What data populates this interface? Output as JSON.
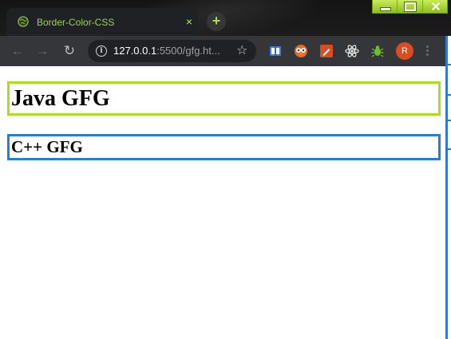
{
  "browser": {
    "tab": {
      "title": "Border-Color-CSS",
      "close_glyph": "×",
      "favicon": "globe-icon"
    },
    "new_tab_glyph": "+",
    "nav": {
      "back_glyph": "←",
      "forward_glyph": "→",
      "reload_glyph": "↻"
    },
    "omnibox": {
      "url_host": "127.0.0.1",
      "url_path": ":5500/gfg.ht...",
      "info_glyph": "i",
      "star_glyph": "☆"
    },
    "extensions": [
      {
        "icon": "book-icon",
        "color": "#3d7fd8"
      },
      {
        "icon": "owl-icon",
        "color": "#e36b2c"
      },
      {
        "icon": "pen-icon",
        "color": "#dd4b21"
      },
      {
        "icon": "react-atom-icon",
        "color": "#e8e8e8"
      },
      {
        "icon": "bug-icon",
        "color": "#6fbf2a"
      }
    ],
    "profile_initial": "R"
  },
  "page": {
    "heading1": {
      "text": "Java GFG",
      "border_color": "#a9dd1f"
    },
    "heading2": {
      "text": "C++ GFG",
      "border_color": "#2b7bd6"
    }
  }
}
